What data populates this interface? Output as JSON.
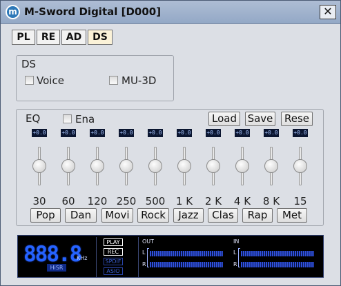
{
  "window": {
    "title": "M-Sword Digital [D000]",
    "icon_letter": "m",
    "close_label": "✕"
  },
  "tabs": [
    {
      "label": "PL",
      "active": false
    },
    {
      "label": "RE",
      "active": false
    },
    {
      "label": "AD",
      "active": false
    },
    {
      "label": "DS",
      "active": true
    }
  ],
  "ds": {
    "group_label": "DS",
    "voice_label": "Voice",
    "voice_checked": false,
    "mu3d_label": "MU-3D",
    "mu3d_checked": false
  },
  "eq": {
    "group_label": "EQ",
    "enable_label": "Ena",
    "enable_checked": false,
    "load_label": "Load",
    "save_label": "Save",
    "reset_label": "Rese",
    "bands": [
      {
        "freq": "30",
        "db": "+0.0"
      },
      {
        "freq": "60",
        "db": "+0.0"
      },
      {
        "freq": "120",
        "db": "+0.0"
      },
      {
        "freq": "250",
        "db": "+0.0"
      },
      {
        "freq": "500",
        "db": "+0.0"
      },
      {
        "freq": "1 K",
        "db": "+0.0"
      },
      {
        "freq": "2 K",
        "db": "+0.0"
      },
      {
        "freq": "4 K",
        "db": "+0.0"
      },
      {
        "freq": "8 K",
        "db": "+0.0"
      },
      {
        "freq": "15",
        "db": "+0.0"
      }
    ],
    "presets": [
      "Pop",
      "Dan",
      "Movi",
      "Rock",
      "Jazz",
      "Clas",
      "Rap",
      "Met"
    ]
  },
  "display": {
    "sample_rate": "888.8",
    "unit": "KHz",
    "hi_sr_label": "HiSR",
    "modes": [
      {
        "label": "PLAY",
        "lit": true
      },
      {
        "label": "REC",
        "lit": true
      },
      {
        "label": "SPDIF",
        "lit": false
      },
      {
        "label": "ASIO",
        "lit": false
      }
    ],
    "out_label": "OUT",
    "in_label": "IN",
    "left_label": "L",
    "right_label": "R"
  },
  "colors": {
    "lcd_digits": "#2563ff",
    "window_bg": "#dcdfe5",
    "active_tab": "#fbf2d8"
  }
}
